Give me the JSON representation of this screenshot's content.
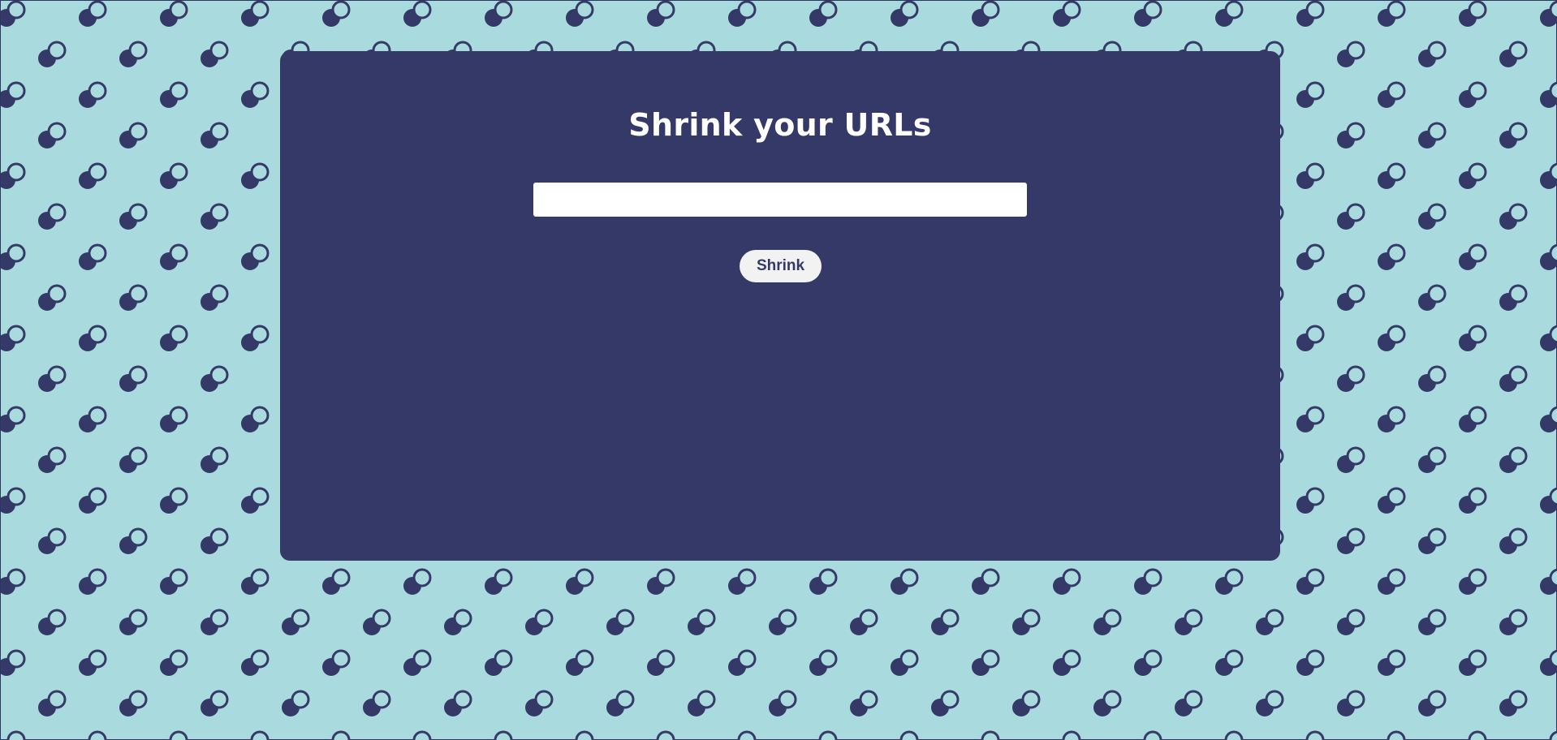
{
  "page": {
    "title": "Shrink your URLs"
  },
  "form": {
    "url_value": "",
    "url_placeholder": "",
    "submit_label": "Shrink"
  },
  "theme": {
    "background": "#a9dade",
    "card": "#353968",
    "pattern_dark": "#353968",
    "pattern_ring": "#a9dade",
    "button_bg": "#f2f2f2",
    "button_text": "#353968"
  },
  "decoration": {
    "background_icon": "overlapping-circles-icon"
  }
}
